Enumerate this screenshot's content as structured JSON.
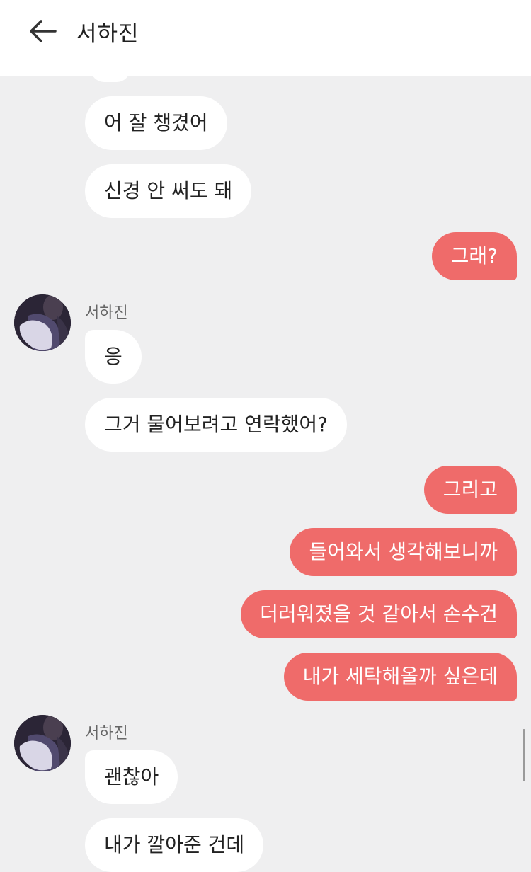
{
  "header": {
    "title": "서하진"
  },
  "messages": [
    {
      "side": "in",
      "text": "어 잘 챙겼어"
    },
    {
      "side": "in",
      "text": "신경 안 써도 돼"
    },
    {
      "side": "out",
      "text": "그래?"
    },
    {
      "side": "in",
      "sender": "서하진",
      "text": "응"
    },
    {
      "side": "in",
      "text": "그거 물어보려고 연락했어?"
    },
    {
      "side": "out",
      "text": "그리고"
    },
    {
      "side": "out",
      "text": "들어와서 생각해보니까"
    },
    {
      "side": "out",
      "text": "더러워졌을 것 같아서 손수건"
    },
    {
      "side": "out",
      "text": "내가 세탁해올까 싶은데"
    },
    {
      "side": "in",
      "sender": "서하진",
      "text": "괜찮아"
    },
    {
      "side": "in",
      "text": "내가 깔아준 건데"
    }
  ],
  "colors": {
    "incoming": "#ffffff",
    "outgoing": "#ef6b6a",
    "background": "#efeff0"
  }
}
